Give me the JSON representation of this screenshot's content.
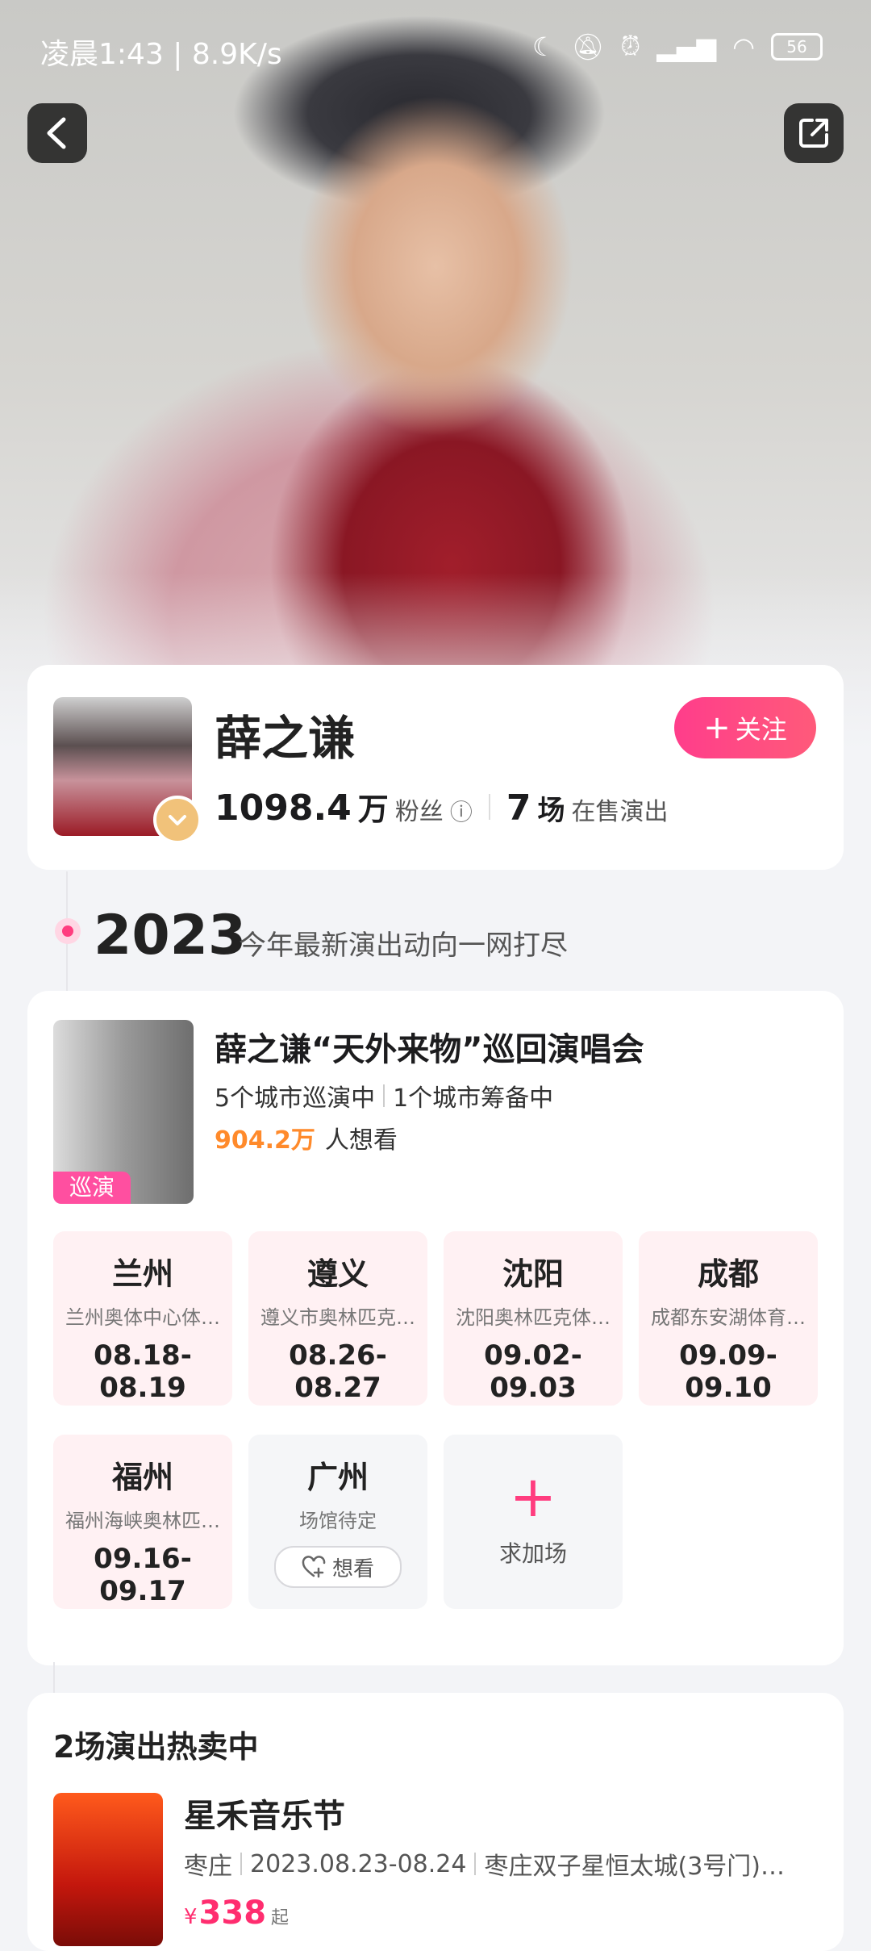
{
  "statusbar": {
    "time": "凌晨1:43 | 8.9K/s",
    "battery": "56"
  },
  "artist": {
    "name": "薛之谦",
    "follow_label": "关注",
    "fans_value": "1098.4",
    "fans_unit": "万",
    "fans_label": "粉丝",
    "shows_value": "7",
    "shows_unit": "场",
    "shows_label": "在售演出"
  },
  "year_section": {
    "year": "2023",
    "subtitle": "今年最新演出动向一网打尽"
  },
  "tour": {
    "title": "薛之谦“天外来物”巡回演唱会",
    "cities_touring": "5个城市巡演中",
    "cities_preparing": "1个城市筹备中",
    "want_count": "904.2万",
    "want_label": "人想看",
    "tag": "巡演",
    "cities": [
      {
        "name": "兰州",
        "venue": "兰州奥体中心体…",
        "date": "08.18-08.19"
      },
      {
        "name": "遵义",
        "venue": "遵义市奥林匹克…",
        "date": "08.26-08.27"
      },
      {
        "name": "沈阳",
        "venue": "沈阳奥林匹克体…",
        "date": "09.02-09.03"
      },
      {
        "name": "成都",
        "venue": "成都东安湖体育…",
        "date": "09.09-09.10"
      },
      {
        "name": "福州",
        "venue": "福州海峡奥林匹…",
        "date": "09.16-09.17"
      }
    ],
    "pending_city": {
      "name": "广州",
      "venue": "场馆待定",
      "want_label": "想看"
    },
    "add_show_label": "求加场"
  },
  "hot": {
    "title": "2场演出热卖中",
    "show": {
      "name": "星禾音乐节",
      "city": "枣庄",
      "date": "2023.08.23-08.24",
      "venue": "枣庄双子星恒太城(3号门)…",
      "currency": "¥",
      "price": "338",
      "price_suffix": "起"
    }
  },
  "colors": {
    "accent": "#ff3d7f",
    "want_count": "#ff8a2b",
    "city_card_bg": "#fff1f3"
  }
}
